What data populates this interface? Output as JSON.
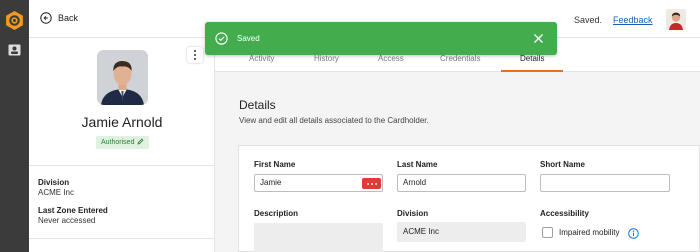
{
  "topbar": {
    "back_label": "Back",
    "saved_label": "Saved.",
    "feedback_label": "Feedback"
  },
  "toast": {
    "message": "Saved",
    "color": "#43ad4e"
  },
  "profile": {
    "name": "Jamie Arnold",
    "status_badge": "Authorised",
    "division_label": "Division",
    "division_value": "ACME Inc",
    "last_zone_label": "Last Zone Entered",
    "last_zone_value": "Never accessed"
  },
  "tabs": [
    {
      "label": "Activity"
    },
    {
      "label": "History"
    },
    {
      "label": "Access"
    },
    {
      "label": "Credentials"
    },
    {
      "label": "Details",
      "active": true
    }
  ],
  "details": {
    "title": "Details",
    "subtitle": "View and edit all details associated to the Cardholder.",
    "first_name_label": "First Name",
    "first_name_value": "Jamie",
    "last_name_label": "Last Name",
    "last_name_value": "Arnold",
    "short_name_label": "Short Name",
    "short_name_value": "",
    "description_label": "Description",
    "division_label": "Division",
    "division_value": "ACME Inc",
    "accessibility_label": "Accessibility",
    "impaired_mobility_label": "Impaired mobility"
  },
  "colors": {
    "accent": "#e96f20",
    "rail": "#3b3b3b",
    "link": "#1a5fb4",
    "badge_bg": "#dff1e1",
    "badge_text": "#2e7d32"
  }
}
